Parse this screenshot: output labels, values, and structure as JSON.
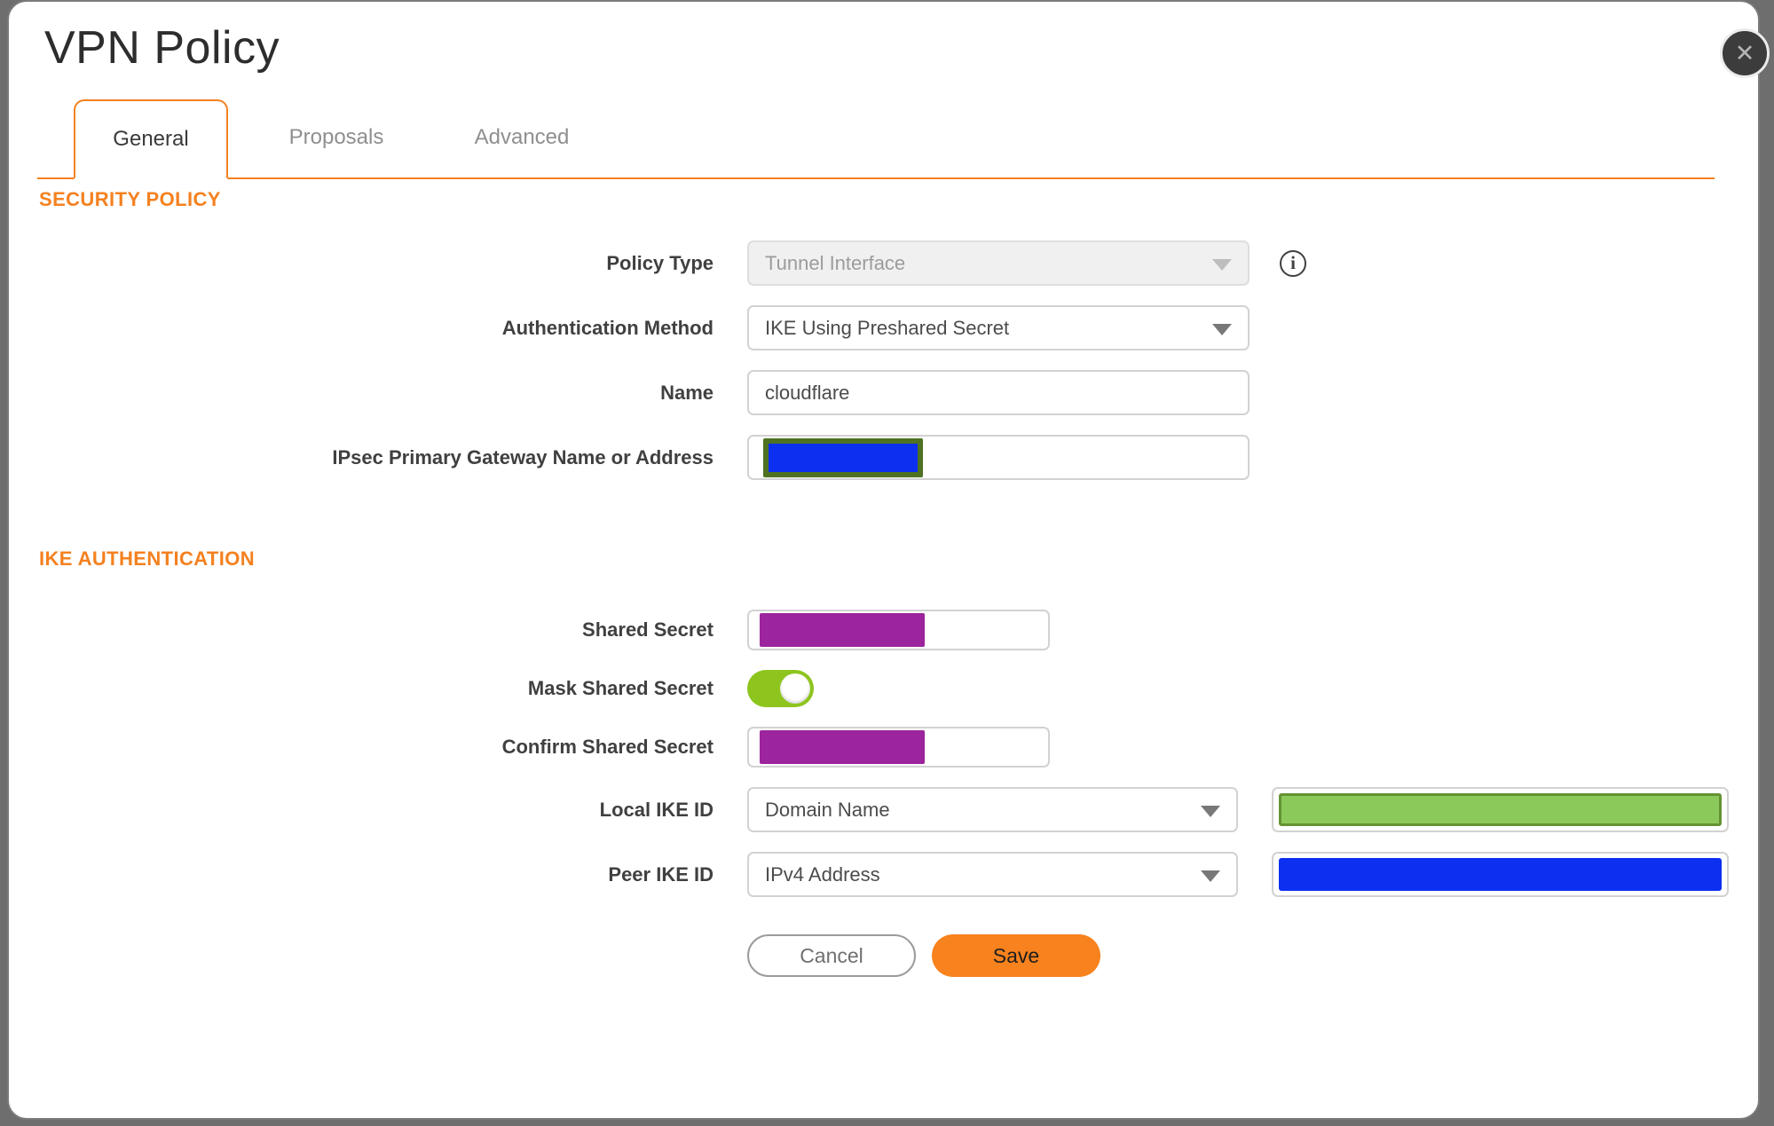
{
  "colors": {
    "accent": "#f48120",
    "save_bg": "#f8821e",
    "mask_purple": "#9c249c",
    "mask_blue": "#0d2ff0",
    "mask_green": "#8cc95b",
    "mask_green_border": "#649332",
    "mask_blue_border": "#4e7222",
    "toggle_green": "#8dc51e",
    "backdrop": "#6e6e6e"
  },
  "icons": {
    "close": "✕",
    "info": "i"
  },
  "dialog": {
    "title": "VPN Policy"
  },
  "tabs": [
    {
      "label": "General",
      "active": true
    },
    {
      "label": "Proposals",
      "active": false
    },
    {
      "label": "Advanced",
      "active": false
    }
  ],
  "sections": {
    "security_policy": {
      "heading": "SECURITY POLICY",
      "policy_type": {
        "label": "Policy Type",
        "value": "Tunnel Interface",
        "disabled": true
      },
      "auth_method": {
        "label": "Authentication Method",
        "value": "IKE Using Preshared Secret"
      },
      "name": {
        "label": "Name",
        "value": "cloudflare"
      },
      "gateway": {
        "label": "IPsec Primary Gateway Name or Address",
        "value": "",
        "masked": true,
        "mask_color": "#0d2ff0"
      }
    },
    "ike_authentication": {
      "heading": "IKE AUTHENTICATION",
      "shared_secret": {
        "label": "Shared Secret",
        "value": "",
        "masked": true,
        "mask_color": "#9c249c"
      },
      "mask_shared_secret": {
        "label": "Mask Shared Secret",
        "enabled": true
      },
      "confirm_shared_secret": {
        "label": "Confirm Shared Secret",
        "value": "",
        "masked": true,
        "mask_color": "#9c249c"
      },
      "local_ike_id": {
        "label": "Local IKE ID",
        "type_value": "Domain Name",
        "id_value": "",
        "masked": true,
        "mask_color": "#8cc95b"
      },
      "peer_ike_id": {
        "label": "Peer IKE ID",
        "type_value": "IPv4 Address",
        "id_value": "",
        "masked": true,
        "mask_color": "#0d2ff0"
      }
    }
  },
  "actions": {
    "cancel": "Cancel",
    "save": "Save"
  }
}
